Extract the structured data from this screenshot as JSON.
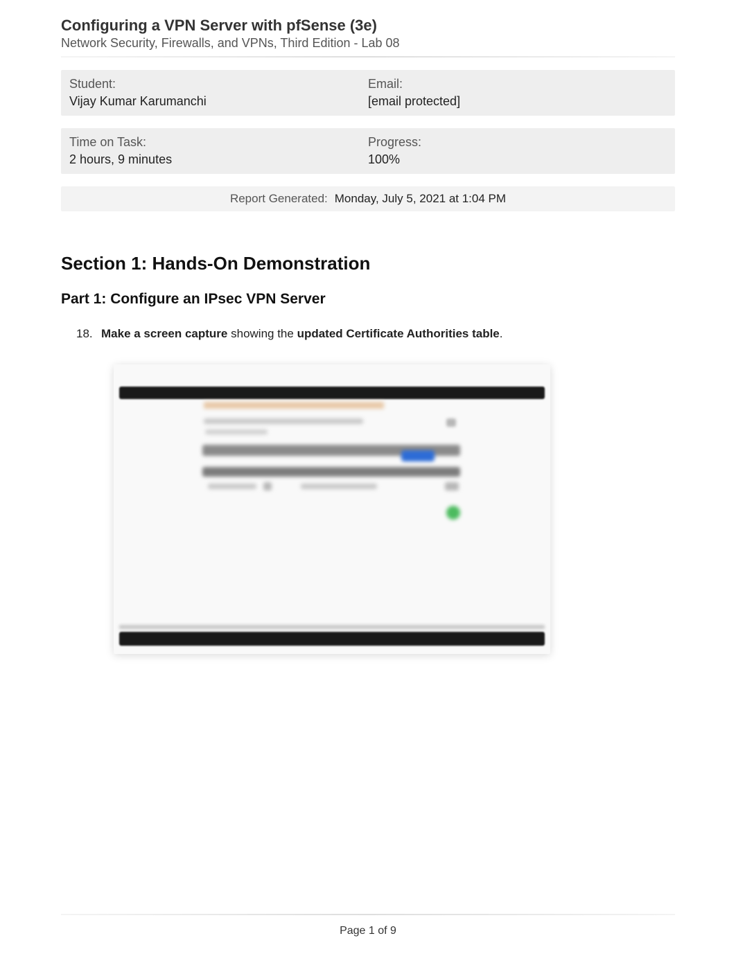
{
  "header": {
    "title": "Configuring a VPN Server with pfSense (3e)",
    "subtitle": "Network Security, Firewalls, and VPNs, Third Edition - Lab 08"
  },
  "info": {
    "student_label": "Student:",
    "student_value": "Vijay Kumar Karumanchi",
    "email_label": "Email:",
    "email_value": "[email protected]",
    "time_label": "Time on Task:",
    "time_value": "2 hours, 9 minutes",
    "progress_label": "Progress:",
    "progress_value": "100%"
  },
  "report": {
    "label": "Report Generated:",
    "value": "Monday, July 5, 2021 at 1:04 PM"
  },
  "section": {
    "title": "Section 1: Hands-On Demonstration",
    "part_title": "Part 1: Configure an IPsec VPN Server"
  },
  "step": {
    "number": "18.",
    "bold1": "Make a screen capture",
    "mid": " showing the ",
    "bold2": "updated Certificate Authorities table",
    "end": "."
  },
  "footer": {
    "page_text": "Page 1 of 9"
  }
}
